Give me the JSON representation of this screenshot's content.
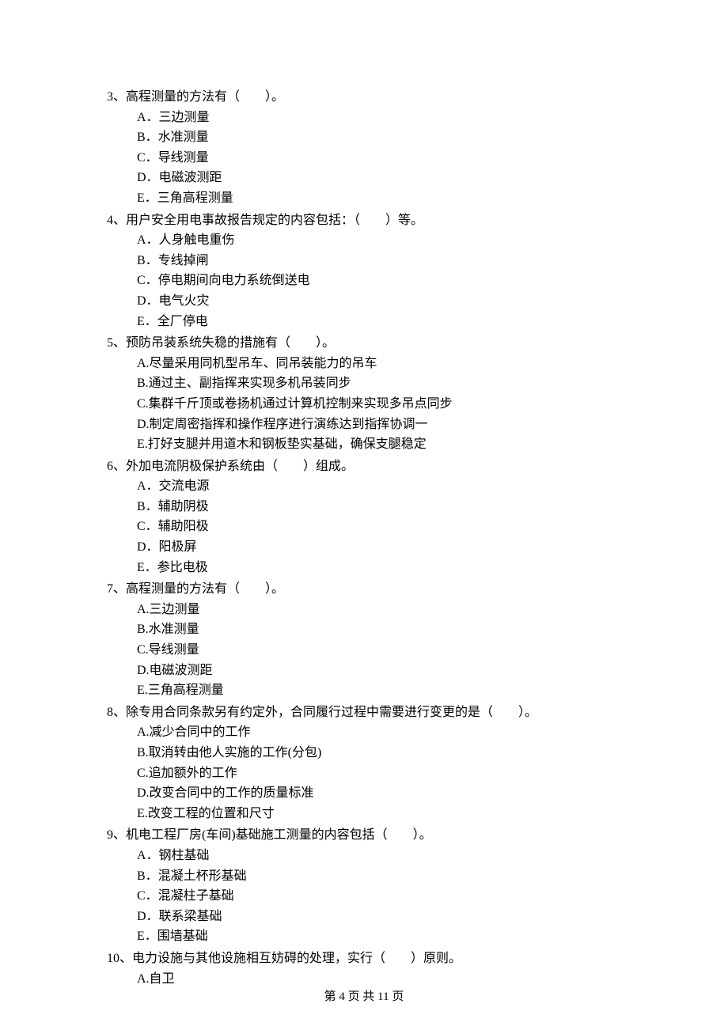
{
  "questions": [
    {
      "num": "3",
      "stem": "、高程测量的方法有（　　）。",
      "options": [
        "A．三边测量",
        "B．水准测量",
        "C．导线测量",
        "D．电磁波测距",
        "E．三角高程测量"
      ]
    },
    {
      "num": "4",
      "stem": "、用户安全用电事故报告规定的内容包括：（　　）等。",
      "options": [
        "A．人身触电重伤",
        "B．专线掉闸",
        "C．停电期间向电力系统倒送电",
        "D．电气火灾",
        "E．全厂停电"
      ]
    },
    {
      "num": "5",
      "stem": "、预防吊装系统失稳的措施有（　　）。",
      "options": [
        "A.尽量采用同机型吊车、同吊装能力的吊车",
        "B.通过主、副指挥来实现多机吊装同步",
        "C.集群千斤顶或卷扬机通过计算机控制来实现多吊点同步",
        "D.制定周密指挥和操作程序进行演练达到指挥协调一",
        "E.打好支腿并用道木和钢板垫实基础，确保支腿稳定"
      ]
    },
    {
      "num": "6",
      "stem": "、外加电流阴极保护系统由（　　）组成。",
      "options": [
        "A．交流电源",
        "B．辅助阴极",
        "C．辅助阳极",
        "D．阳极屏",
        "E．参比电极"
      ]
    },
    {
      "num": "7",
      "stem": "、高程测量的方法有（　　）。",
      "options": [
        "A.三边测量",
        "B.水准测量",
        "C.导线测量",
        "D.电磁波测距",
        "E.三角高程测量"
      ]
    },
    {
      "num": "8",
      "stem": "、除专用合同条款另有约定外，合同履行过程中需要进行变更的是（　　）。",
      "options": [
        "A.减少合同中的工作",
        "B.取消转由他人实施的工作(分包)",
        "C.追加额外的工作",
        "D.改变合同中的工作的质量标准",
        "E.改变工程的位置和尺寸"
      ]
    },
    {
      "num": "9",
      "stem": "、机电工程厂房(车间)基础施工测量的内容包括（　　）。",
      "options": [
        "A．钢柱基础",
        "B．混凝土杯形基础",
        "C．混凝柱子基础",
        "D．联系梁基础",
        "E．围墙基础"
      ]
    },
    {
      "num": "10",
      "stem": "、电力设施与其他设施相互妨碍的处理，实行（　　）原则。",
      "options": [
        "A.自卫"
      ]
    }
  ],
  "footer": "第 4 页 共 11 页"
}
